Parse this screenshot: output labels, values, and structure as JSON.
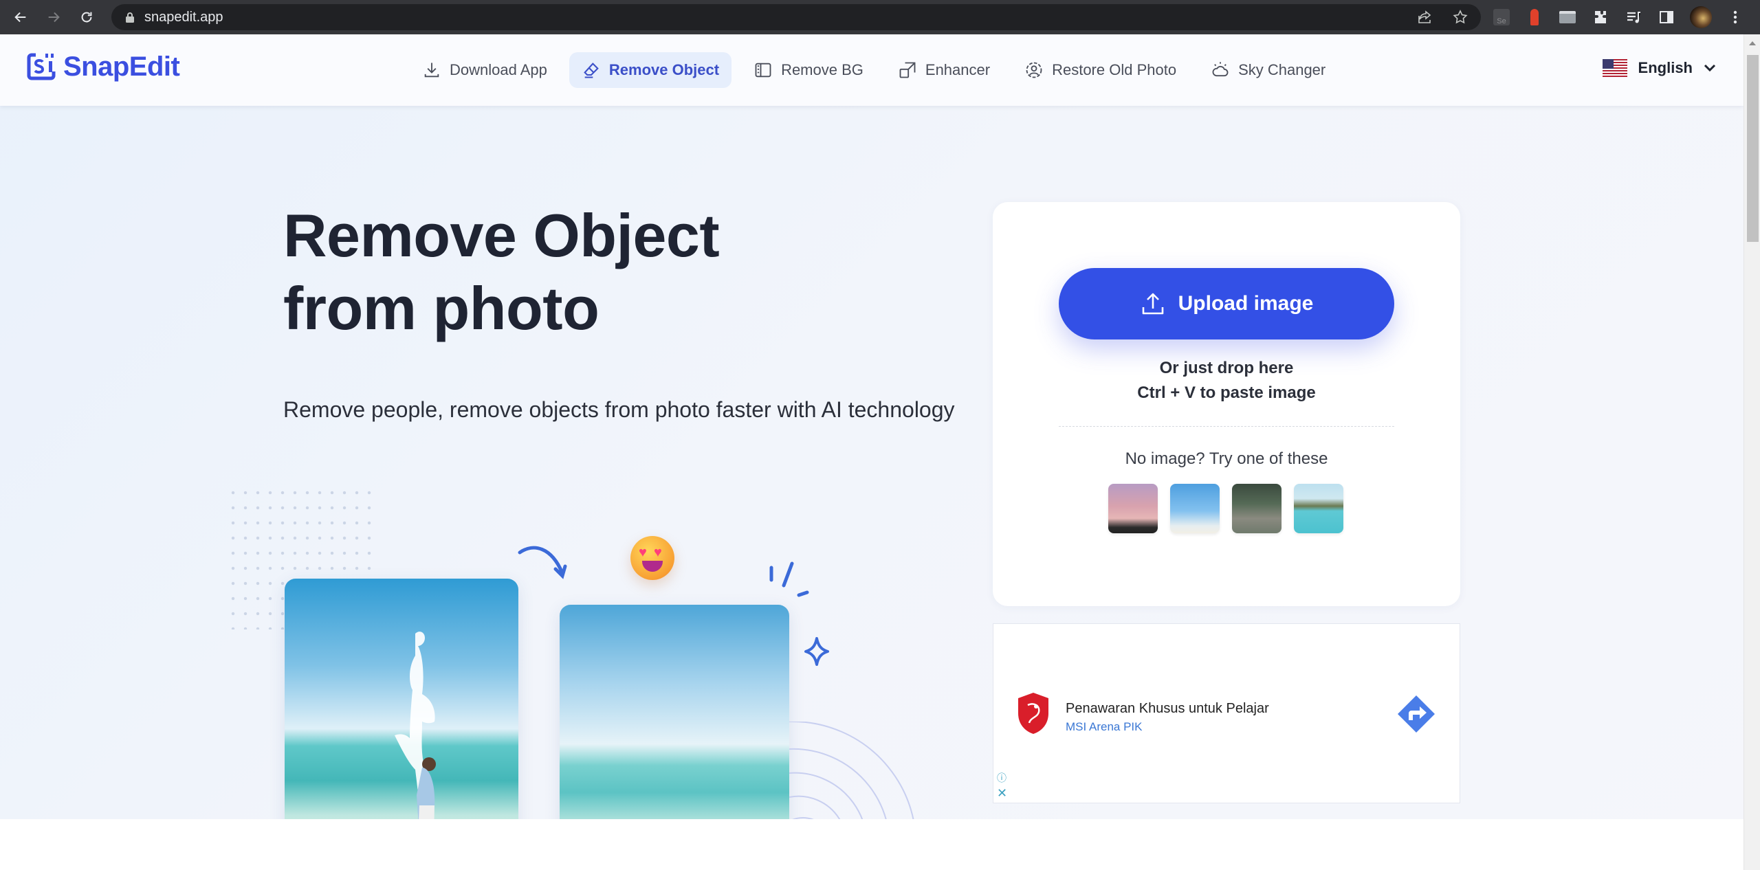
{
  "browser": {
    "url": "snapedit.app",
    "back_icon": "arrow-left-icon",
    "forward_icon": "arrow-right-icon",
    "reload_icon": "reload-icon",
    "extensions": [
      "snapedit-extension-icon",
      "lighthouse-icon",
      "window-icon",
      "puzzle-icon",
      "media-queue-icon",
      "side-panel-icon",
      "profile-avatar",
      "kebab-menu-icon"
    ]
  },
  "header": {
    "logo_text": "SnapEdit",
    "nav": [
      {
        "label": "Download App",
        "icon": "download-icon",
        "active": false
      },
      {
        "label": "Remove Object",
        "icon": "eraser-icon",
        "active": true
      },
      {
        "label": "Remove BG",
        "icon": "remove-bg-icon",
        "active": false
      },
      {
        "label": "Enhancer",
        "icon": "enhance-icon",
        "active": false
      },
      {
        "label": "Restore Old Photo",
        "icon": "restore-icon",
        "active": false
      },
      {
        "label": "Sky Changer",
        "icon": "sky-icon",
        "active": false
      }
    ],
    "language": "English"
  },
  "hero": {
    "title_line1": "Remove Object",
    "title_line2": "from photo",
    "subtitle": "Remove people, remove objects from photo faster with AI technology"
  },
  "upload": {
    "button_label": "Upload image",
    "drop_text": "Or just drop here",
    "paste_text": "Ctrl + V to paste image",
    "try_text": "No image? Try one of these",
    "samples": [
      "hot-air-balloons",
      "people-jumping-beach",
      "friends-sitting-park",
      "island-sea"
    ]
  },
  "ad": {
    "title": "Penawaran Khusus untuk Pelajar",
    "advertiser": "MSI Arena PIK"
  },
  "colors": {
    "brand": "#3b4fe0",
    "button": "#3350e6",
    "highlight": "#3ff2f2",
    "active_nav_bg": "#e6eefc"
  }
}
